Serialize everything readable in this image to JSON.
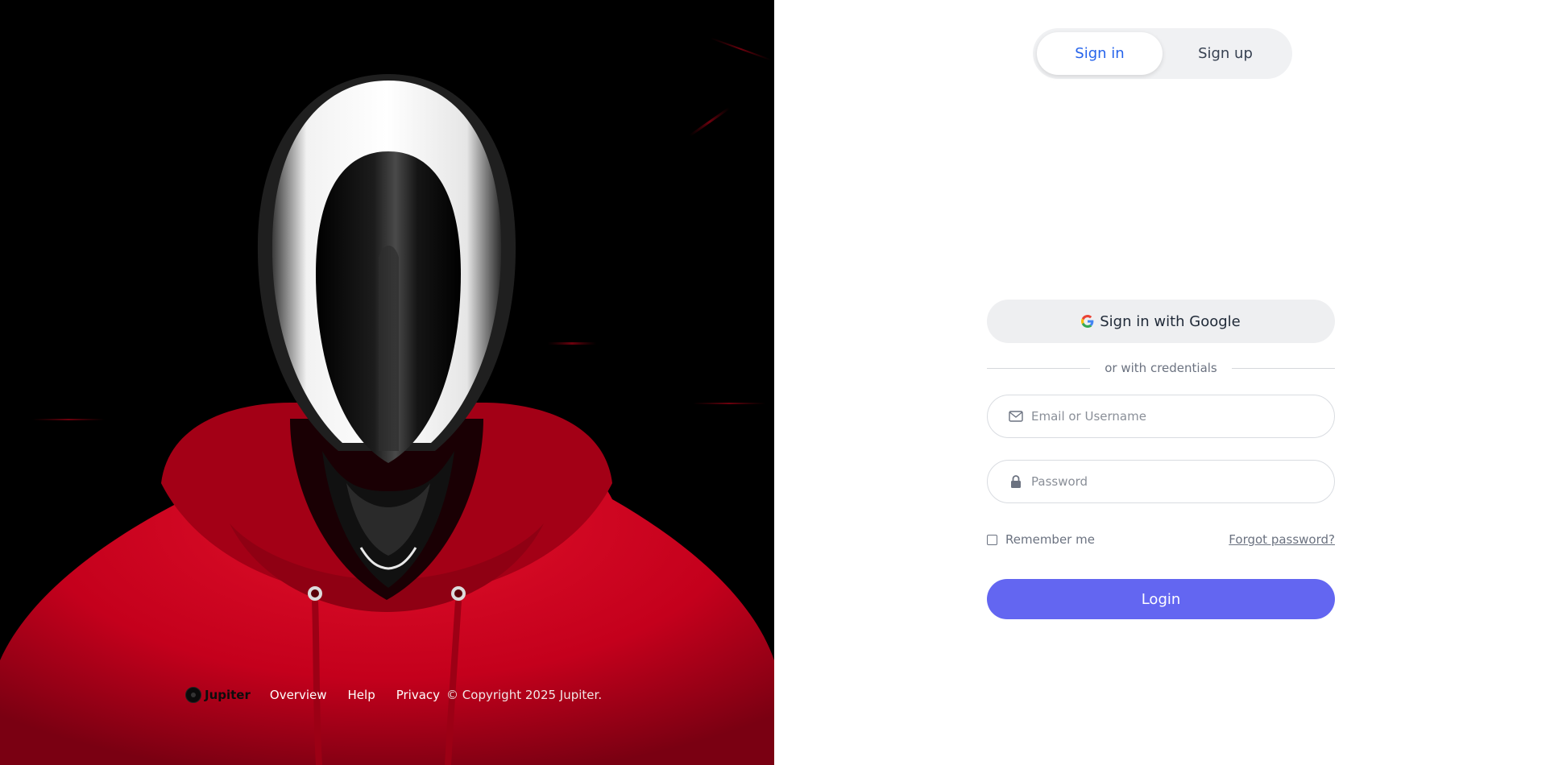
{
  "hero": {
    "image": "mannequin-red-hoodie-illustration",
    "colors": {
      "background": "#000000",
      "hoodie": "#c8001c",
      "visor": "#0a0a0a",
      "helmet": "#e8e8e8"
    }
  },
  "footer": {
    "brand_name": "Jupiter",
    "links": [
      "Overview",
      "Help",
      "Privacy"
    ],
    "copyright": "© Copyright 2025 Jupiter."
  },
  "auth": {
    "tabs": [
      {
        "label": "Sign in",
        "active": true
      },
      {
        "label": "Sign up",
        "active": false
      }
    ],
    "google_button": "Sign in with Google",
    "divider_text": "or with credentials",
    "email_placeholder": "Email or Username",
    "password_placeholder": "Password",
    "remember_label": "Remember me",
    "forgot_label": "Forgot password?",
    "login_label": "Login"
  },
  "colors": {
    "accent": "#6366f1",
    "active_tab_text": "#2563eb",
    "muted_text": "#6b7280"
  },
  "icons": {
    "google": "google-icon",
    "email": "mail-icon",
    "password": "lock-icon",
    "logo": "jupiter-logo-icon"
  }
}
